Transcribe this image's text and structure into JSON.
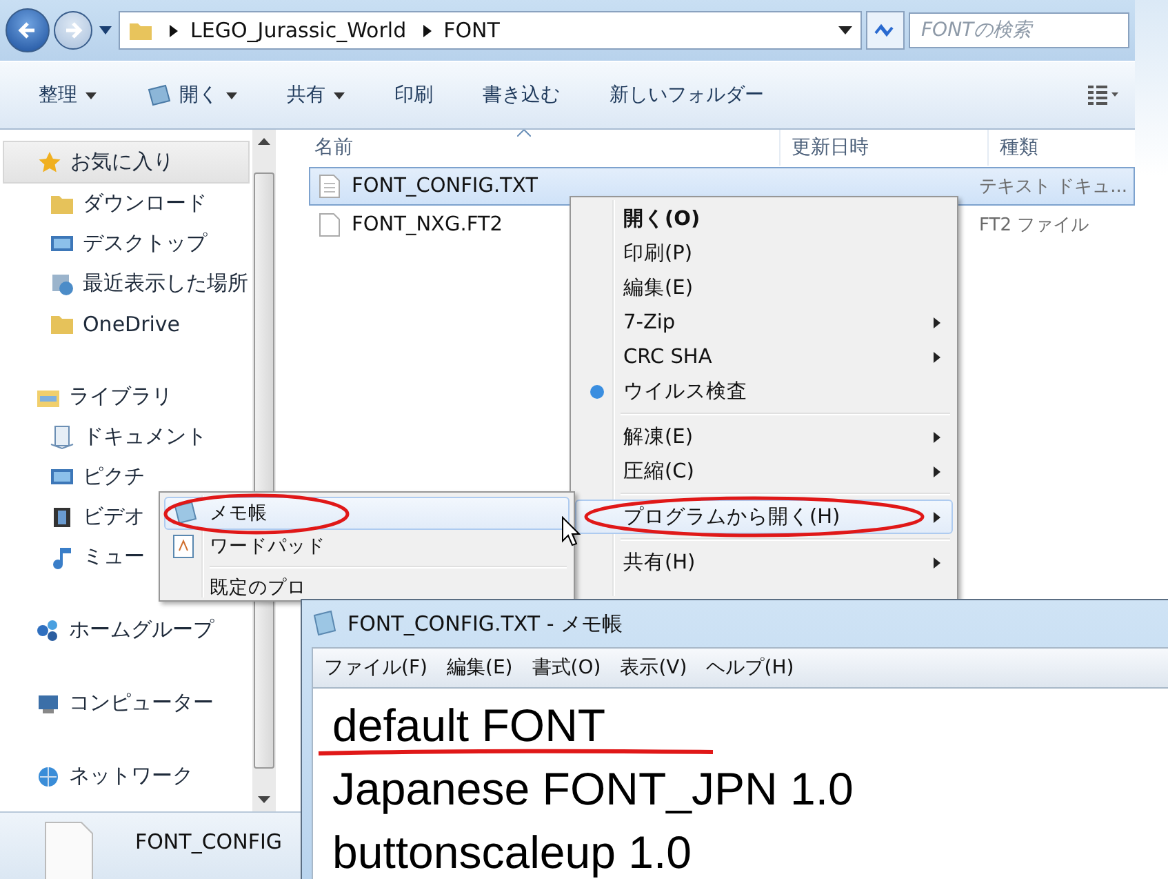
{
  "address_bar": {
    "path": [
      "LEGO_Jurassic_World",
      "FONT"
    ],
    "search": {
      "placeholder": "FONTの検索"
    }
  },
  "toolbar": [
    {
      "label": "整理",
      "menu": true,
      "icon": false
    },
    {
      "label": "開く",
      "menu": true,
      "icon": true
    },
    {
      "label": "共有",
      "menu": true,
      "icon": false
    },
    {
      "label": "印刷",
      "menu": false,
      "icon": false
    },
    {
      "label": "書き込む",
      "menu": false,
      "icon": false
    },
    {
      "label": "新しいフォルダー",
      "menu": false,
      "icon": false
    }
  ],
  "sidebar": {
    "items": [
      {
        "label": "お気に入り",
        "selected": true,
        "children": [
          {
            "label": "ダウンロード",
            "selected": false
          },
          {
            "label": "デスクトップ",
            "selected": false
          },
          {
            "label": "最近表示した場所",
            "selected": false
          },
          {
            "label": "OneDrive",
            "selected": false
          }
        ]
      },
      {
        "label": "ライブラリ",
        "selected": false,
        "children": [
          {
            "label": "ドキュメント",
            "selected": false
          },
          {
            "label": "ピクチ",
            "selected": false
          },
          {
            "label": "ビデオ",
            "selected": false
          },
          {
            "label": "ミュー",
            "selected": false
          }
        ]
      },
      {
        "label": "ホームグループ",
        "selected": false
      },
      {
        "label": "コンピューター",
        "selected": false
      },
      {
        "label": "ネットワーク",
        "selected": false
      }
    ]
  },
  "table": {
    "columns": [
      "名前",
      "更新日時",
      "種類"
    ],
    "rows": [
      {
        "name": "FONT_CONFIG.TXT",
        "type": "テキスト ドキュ...",
        "selected": true
      },
      {
        "name": "FONT_NXG.FT2",
        "type": "FT2 ファイル",
        "selected": false
      }
    ]
  },
  "details_pane": {
    "name": "FONT_CONFIG"
  },
  "context_menu": {
    "items": [
      {
        "kind": "command",
        "label": "開く(O)",
        "bold": true,
        "submenu": false,
        "selected": false
      },
      {
        "kind": "command",
        "label": "印刷(P)",
        "bold": false,
        "submenu": false,
        "selected": false
      },
      {
        "kind": "command",
        "label": "編集(E)",
        "bold": false,
        "submenu": false,
        "selected": false
      },
      {
        "kind": "command",
        "label": "7-Zip",
        "bold": false,
        "submenu": true,
        "selected": false
      },
      {
        "kind": "command",
        "label": "CRC SHA",
        "bold": false,
        "submenu": true,
        "selected": false
      },
      {
        "kind": "scan",
        "label": "ウイルス検査",
        "bold": false,
        "submenu": false,
        "selected": false
      },
      {
        "kind": "separator"
      },
      {
        "kind": "command",
        "label": "解凍(E)",
        "bold": false,
        "submenu": true,
        "selected": false
      },
      {
        "kind": "command",
        "label": "圧縮(C)",
        "bold": false,
        "submenu": true,
        "selected": false
      },
      {
        "kind": "separator"
      },
      {
        "kind": "command",
        "label": "プログラムから開く(H)",
        "bold": false,
        "submenu": true,
        "selected": true
      },
      {
        "kind": "separator"
      },
      {
        "kind": "command",
        "label": "共有(H)",
        "bold": false,
        "submenu": true,
        "selected": false
      }
    ]
  },
  "open_with_menu": {
    "items": [
      {
        "kind": "notepad",
        "label": "メモ帳",
        "selected": true
      },
      {
        "kind": "wordpad",
        "label": "ワードパッド",
        "selected": false
      },
      {
        "kind": "separator"
      },
      {
        "kind": "plain",
        "label": "既定のプロ",
        "selected": false
      }
    ]
  },
  "notepad": {
    "title": "FONT_CONFIG.TXT - メモ帳",
    "menu": [
      "ファイル(F)",
      "編集(E)",
      "書式(O)",
      "表示(V)",
      "ヘルプ(H)"
    ],
    "lines": [
      "default FONT",
      "Japanese FONT_JPN 1.0",
      "buttonscaleup 1.0"
    ]
  }
}
